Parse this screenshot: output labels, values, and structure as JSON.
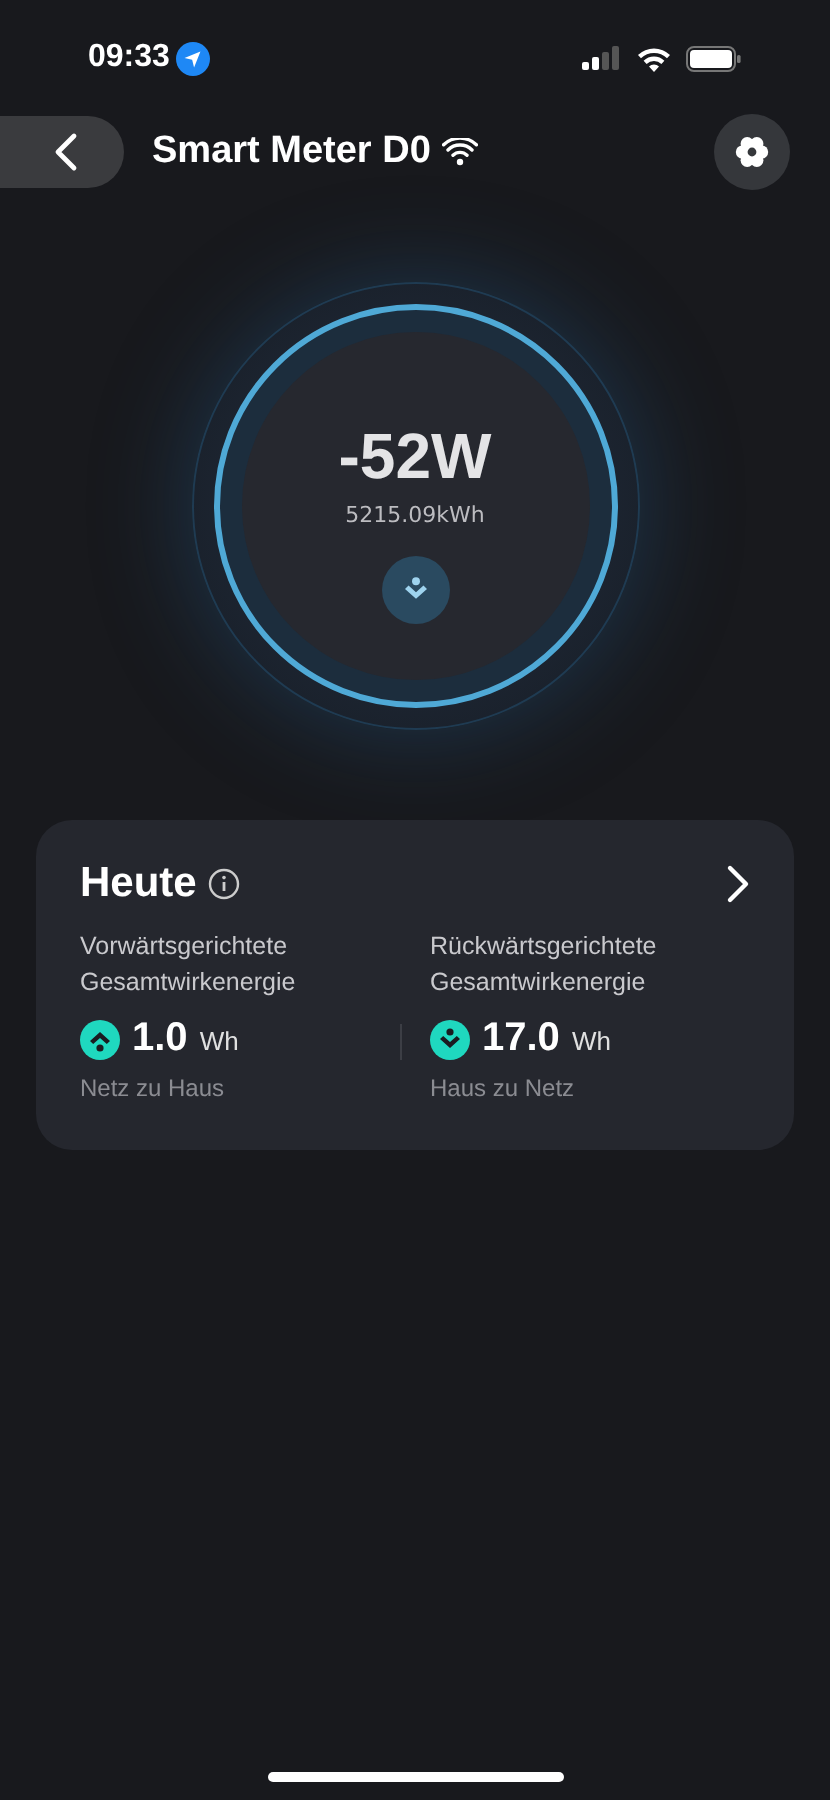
{
  "status_bar": {
    "time": "09:33"
  },
  "header": {
    "title": "Smart Meter D0"
  },
  "meter": {
    "power": "-52W",
    "total": "5215.09kWh"
  },
  "today": {
    "title": "Heute",
    "stats": [
      {
        "label": "Vorwärtsgerichtete Gesamtwirkenergie",
        "kind": "import",
        "value": "1.0",
        "unit": "Wh",
        "caption": "Netz zu Haus"
      },
      {
        "label": "Rückwärtsgerichtete Gesamtwirkenergie",
        "kind": "export",
        "value": "17.0",
        "unit": "Wh",
        "caption": "Haus zu Netz"
      }
    ]
  }
}
